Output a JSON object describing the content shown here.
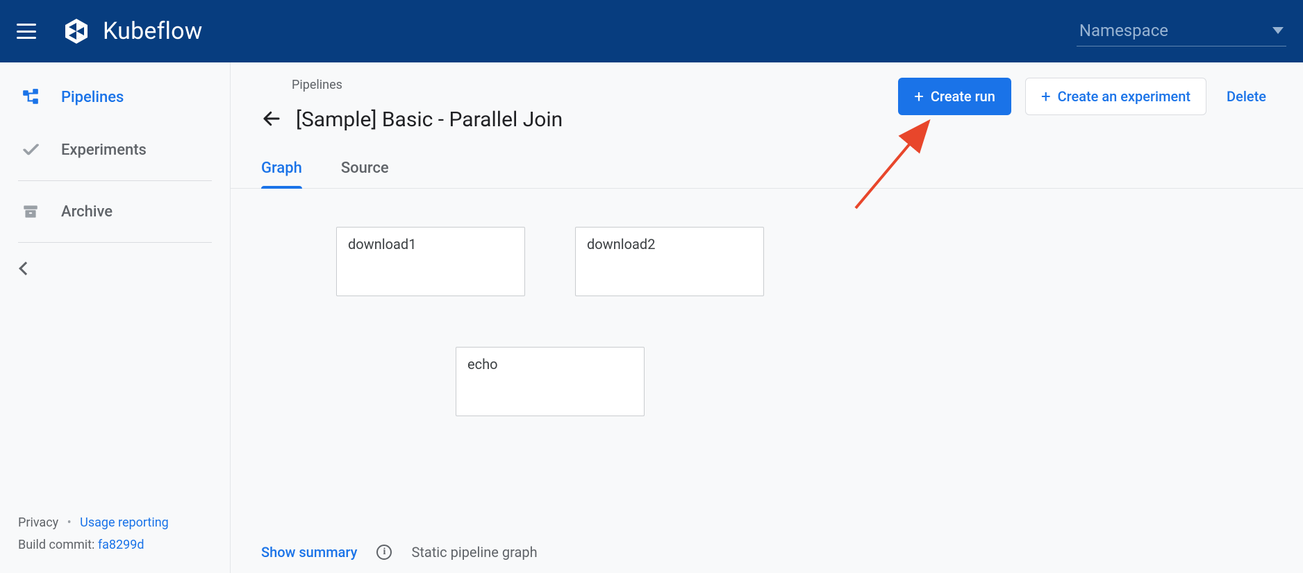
{
  "app": {
    "name": "Kubeflow"
  },
  "namespace": {
    "label": "Namespace"
  },
  "sidebar": {
    "items": [
      {
        "label": "Pipelines"
      },
      {
        "label": "Experiments"
      },
      {
        "label": "Archive"
      }
    ],
    "footer": {
      "privacy": "Privacy",
      "usage": "Usage reporting",
      "build_prefix": "Build commit: ",
      "build_hash": "fa8299d"
    }
  },
  "page": {
    "breadcrumb": "Pipelines",
    "title": "[Sample] Basic - Parallel Join",
    "actions": {
      "create_run": "Create run",
      "create_experiment": "Create an experiment",
      "delete": "Delete"
    },
    "tabs": {
      "graph": "Graph",
      "source": "Source"
    },
    "footer": {
      "show_summary": "Show summary",
      "static_note": "Static pipeline graph"
    }
  },
  "graph": {
    "nodes": [
      {
        "id": "download1",
        "label": "download1"
      },
      {
        "id": "download2",
        "label": "download2"
      },
      {
        "id": "echo",
        "label": "echo"
      }
    ]
  }
}
